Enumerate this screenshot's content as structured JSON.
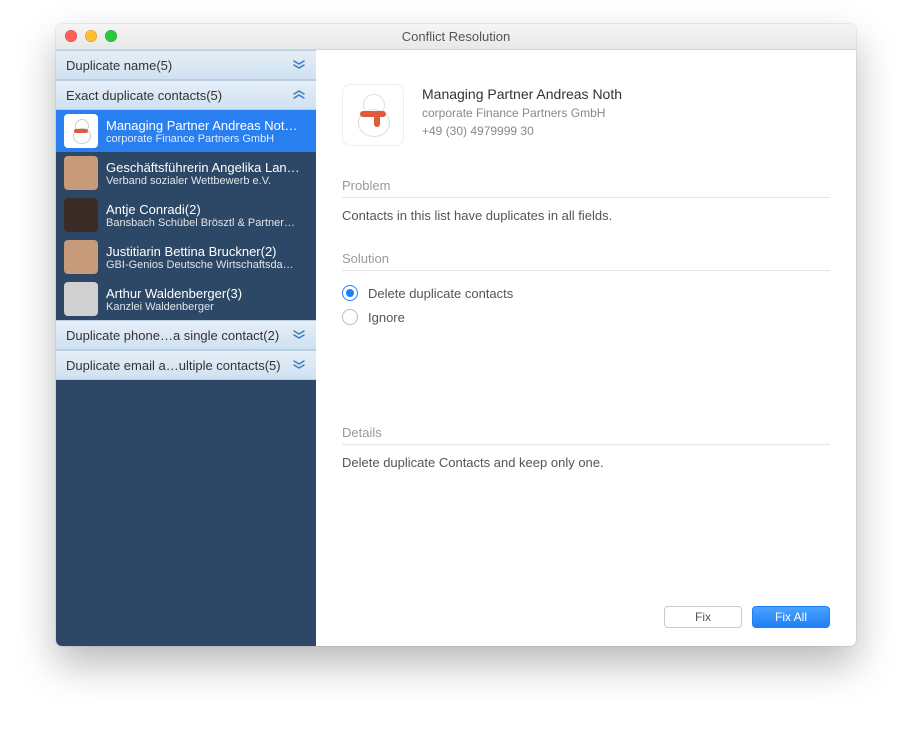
{
  "window": {
    "title": "Conflict Resolution"
  },
  "sidebar": {
    "groups": [
      {
        "label": "Duplicate name",
        "count": "(5)",
        "expanded": false
      },
      {
        "label": "Exact duplicate contacts",
        "count": "(5)",
        "expanded": true,
        "items": [
          {
            "name": "Managing Partner Andreas Not…",
            "sub": "corporate Finance Partners GmbH",
            "avatar": "snow",
            "selected": true
          },
          {
            "name": "Geschäftsführerin Angelika Lan…",
            "sub": "Verband sozialer Wettbewerb e.V.",
            "avatar": "tan"
          },
          {
            "name": "Antje Conradi(2)",
            "sub": "Bansbach Schübel Brösztl & Partner…",
            "avatar": "dark"
          },
          {
            "name": "Justitiarin Bettina Bruckner(2)",
            "sub": "GBI-Genios Deutsche Wirtschaftsda…",
            "avatar": "tan"
          },
          {
            "name": "Arthur Waldenberger(3)",
            "sub": "Kanzlei Waldenberger",
            "avatar": "grey"
          }
        ]
      },
      {
        "label": "Duplicate phone…a single contact",
        "count": "(2)",
        "expanded": false
      },
      {
        "label": "Duplicate email a…ultiple contacts",
        "count": "(5)",
        "expanded": false
      }
    ]
  },
  "detail": {
    "name": "Managing Partner Andreas Noth",
    "company": "corporate Finance Partners GmbH",
    "phone": "+49 (30) 4979999 30",
    "problem_label": "Problem",
    "problem_text": "Contacts in this list have duplicates in all fields.",
    "solution_label": "Solution",
    "solution_options": [
      {
        "label": "Delete duplicate contacts",
        "selected": true
      },
      {
        "label": "Ignore",
        "selected": false
      }
    ],
    "details_label": "Details",
    "details_text": "Delete duplicate Contacts and keep only one."
  },
  "buttons": {
    "fix": "Fix",
    "fix_all": "Fix All"
  }
}
